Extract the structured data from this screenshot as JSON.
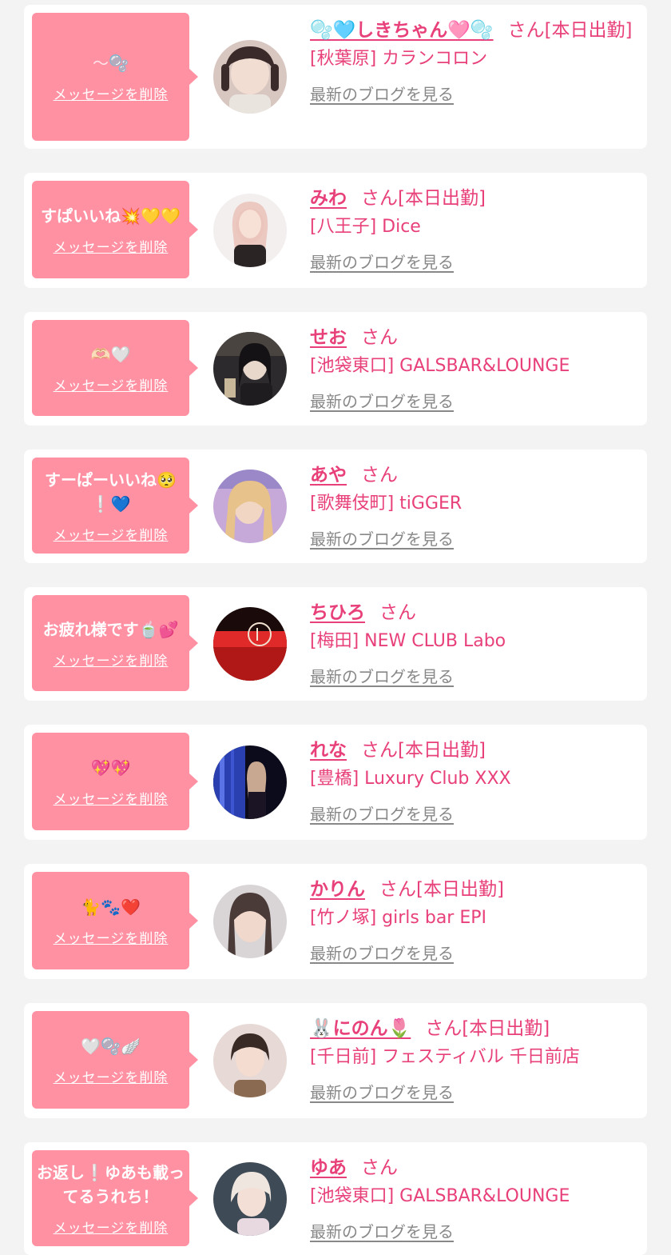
{
  "labels": {
    "delete": "メッセージを削除",
    "blog": "最新のブログを見る",
    "san": "さん"
  },
  "entries": [
    {
      "message": "〜🫧",
      "name": "🫧🩵しきちゃん🩷🫧",
      "shift": "[本日出勤]",
      "shop": "[秋葉原] カランコロン",
      "avatar_colors": [
        "#d8c6c0",
        "#3a2a2a"
      ]
    },
    {
      "message": "すぱいいね💥💛💛",
      "name": "みわ",
      "shift": "[本日出勤]",
      "shop": "[八王子] Dice",
      "avatar_colors": [
        "#f4efef",
        "#2b2425"
      ]
    },
    {
      "message": "🫶🏻🤍",
      "name": "せお",
      "shift": "",
      "shop": "[池袋東口] GALSBAR&LOUNGE",
      "avatar_colors": [
        "#2c2a2c",
        "#c9b79a"
      ]
    },
    {
      "message": "すーぱーいいね🥺❕💙",
      "name": "あや",
      "shift": "",
      "shop": "[歌舞伎町] tiGGER",
      "avatar_colors": [
        "#c6a9d8",
        "#e7c28a"
      ]
    },
    {
      "message": "お疲れ様です🍵💕",
      "name": "ちひろ",
      "shift": "",
      "shop": "[梅田] NEW CLUB Labo",
      "avatar_colors": [
        "#e02a2a",
        "#1a0a0a"
      ]
    },
    {
      "message": "💖💖",
      "name": "れな",
      "shift": "[本日出勤]",
      "shop": "[豊橋] Luxury Club XXX",
      "avatar_colors": [
        "#2a3fb0",
        "#0b0b1c"
      ]
    },
    {
      "message": "🐈🐾❤️",
      "name": "かりん",
      "shift": "[本日出勤]",
      "shop": "[竹ノ塚] girls bar EPI",
      "avatar_colors": [
        "#d9d5d6",
        "#4a3a38"
      ]
    },
    {
      "message": "🤍🫧🪽",
      "name": "🐰にのん🌷",
      "shift": "[本日出勤]",
      "shop": "[千日前] フェスティバル 千日前店",
      "avatar_colors": [
        "#e7d9d5",
        "#3a2a26"
      ]
    },
    {
      "message": "お返し❕ゆあも載ってるうれち！",
      "name": "ゆあ",
      "shift": "",
      "shop": "[池袋東口] GALSBAR&LOUNGE",
      "avatar_colors": [
        "#3e4a55",
        "#f0e6e0"
      ]
    }
  ]
}
